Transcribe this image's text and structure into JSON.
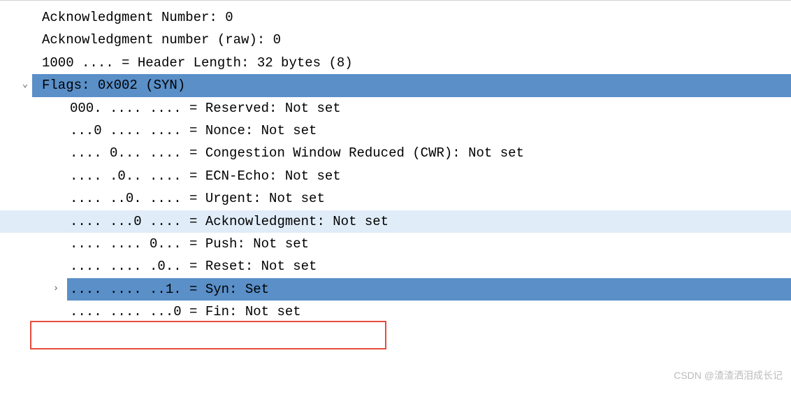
{
  "lines": {
    "ack_number": "Acknowledgment Number: 0",
    "ack_number_raw": "Acknowledgment number (raw): 0",
    "header_length": "1000 .... = Header Length: 32 bytes (8)",
    "flags": "Flags: 0x002 (SYN)",
    "reserved": "000. .... .... = Reserved: Not set",
    "nonce": "...0 .... .... = Nonce: Not set",
    "cwr": ".... 0... .... = Congestion Window Reduced (CWR): Not set",
    "ecn": ".... .0.. .... = ECN-Echo: Not set",
    "urgent": ".... ..0. .... = Urgent: Not set",
    "ack": ".... ...0 .... = Acknowledgment: Not set",
    "push": ".... .... 0... = Push: Not set",
    "reset": ".... .... .0.. = Reset: Not set",
    "syn": ".... .... ..1. = Syn: Set",
    "fin": ".... .... ...0 = Fin: Not set"
  },
  "watermark": "CSDN @渣渣洒泪成长记",
  "carets": {
    "down": "⌄",
    "right": "›"
  }
}
